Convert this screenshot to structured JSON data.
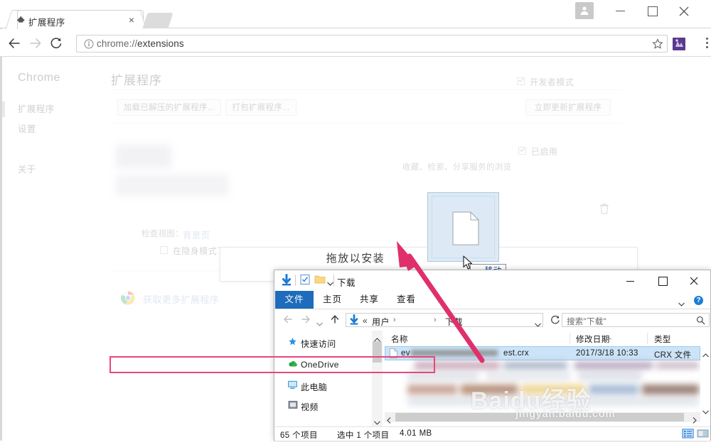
{
  "browser": {
    "tab": {
      "title": "扩展程序",
      "favicon": "puzzle-piece-icon",
      "close": "×"
    },
    "window_controls": {
      "minimize": "—",
      "maximize": "□",
      "close": "✕"
    },
    "omnibox": {
      "scheme": "chrome://",
      "path": "extensions",
      "full": "chrome://extensions",
      "info_icon": "info-circle-icon"
    },
    "nav": {
      "back": "←",
      "forward": "→",
      "reload": "⟳"
    },
    "actions": {
      "bookmark": "star-icon",
      "extension": "extension-icon",
      "menu": "three-dots-icon",
      "profile": "user-avatar-icon"
    }
  },
  "extensions_page": {
    "brand": "Chrome",
    "nav_items": [
      "扩展程序",
      "设置",
      "关于"
    ],
    "heading": "扩展程序",
    "buttons": {
      "load_unpacked": "加载已解压的扩展程序...",
      "pack_extension": "打包扩展程序...",
      "update_now": "立即更新扩展程序"
    },
    "developer_mode": {
      "label": "开发者模式",
      "checked": true
    },
    "extension_card": {
      "enabled_label": "已启用",
      "enabled": true,
      "description": "收藏、检索、分享服务的浏览",
      "inspect_label": "检查视图：",
      "inspect_target": "背景页",
      "incognito_label": "在隐身模式下启用",
      "incognito_checked": false,
      "delete_icon": "trash-icon"
    },
    "more_extensions_link": "获取更多扩展程序",
    "webstore_icon": "chrome-webstore-icon"
  },
  "drop_overlay": {
    "text": "拖放以安装"
  },
  "drag": {
    "ghost_icon": "file-document-icon",
    "cursor": "arrow-cursor-icon",
    "tooltip": "→ 移动"
  },
  "explorer": {
    "title": "下载",
    "quick_access_icons": [
      "download-arrow-icon",
      "properties-icon",
      "new-folder-icon",
      "customize-caret-icon"
    ],
    "window_controls": {
      "minimize": "—",
      "maximize": "□",
      "close": "✕"
    },
    "ribbon_tabs": [
      "文件",
      "主页",
      "共享",
      "查看"
    ],
    "ribbon_active": "文件",
    "ribbon_help": "?",
    "address": {
      "icon": "download-arrow-icon",
      "prefix": "«",
      "crumbs": [
        "用户",
        "",
        "下载"
      ],
      "separator": "›",
      "dropdown": "chevron-down-icon",
      "refresh": "refresh-icon"
    },
    "search": {
      "placeholder": "搜索\"下载\"",
      "icon": "magnifier-icon"
    },
    "nav_pane": [
      {
        "label": "快速访问",
        "icon": "star-pin-icon"
      },
      {
        "label": "OneDrive",
        "icon": "onedrive-cloud-icon"
      },
      {
        "label": "此电脑",
        "icon": "this-pc-icon"
      },
      {
        "label": "视频",
        "icon": "videos-folder-icon"
      }
    ],
    "columns": [
      "名称",
      "修改日期",
      "类型"
    ],
    "rows": [
      {
        "name_prefix": "ev",
        "name_suffix": "est.crx",
        "modified": "2017/3/18 10:33",
        "type": "CRX 文件",
        "selected": true,
        "icon": "file-document-icon"
      }
    ],
    "status": {
      "item_count": "65 个项目",
      "selection": "选中 1 个项目",
      "size": "4.01 MB"
    },
    "view_buttons": {
      "details": "details-view-icon",
      "large_icons": "large-icons-view-icon",
      "active": "details-view-icon"
    }
  },
  "annotation": {
    "arrow_color": "#e0306b",
    "highlight_color": "#e8457c"
  },
  "watermark": {
    "line1": "Baidu经验",
    "line2": "jingyan.baidu.com"
  }
}
